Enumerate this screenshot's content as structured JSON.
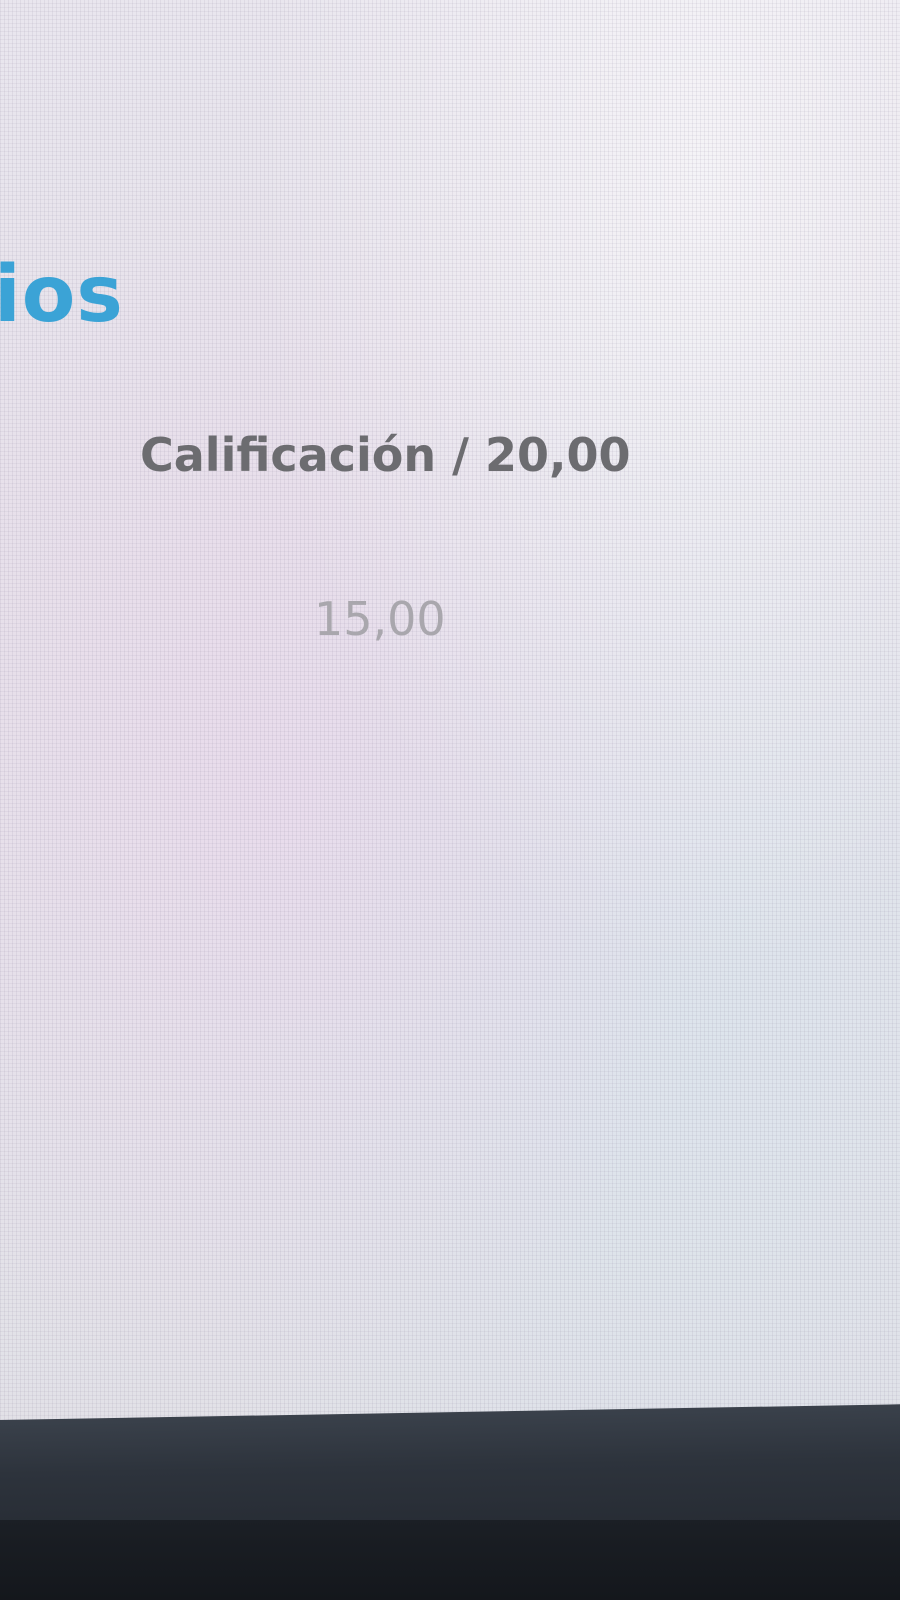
{
  "section": {
    "heading_partial": "ios",
    "heading_color": "#3ba3d6"
  },
  "grades_table": {
    "column_header": "Calificación / 20,00",
    "value": "15,00"
  },
  "colors": {
    "screen_background": "#e7e4ec",
    "header_text": "#6c6c70",
    "value_text": "#a9a7ad",
    "monitor_bezel": "#2a2f38"
  }
}
